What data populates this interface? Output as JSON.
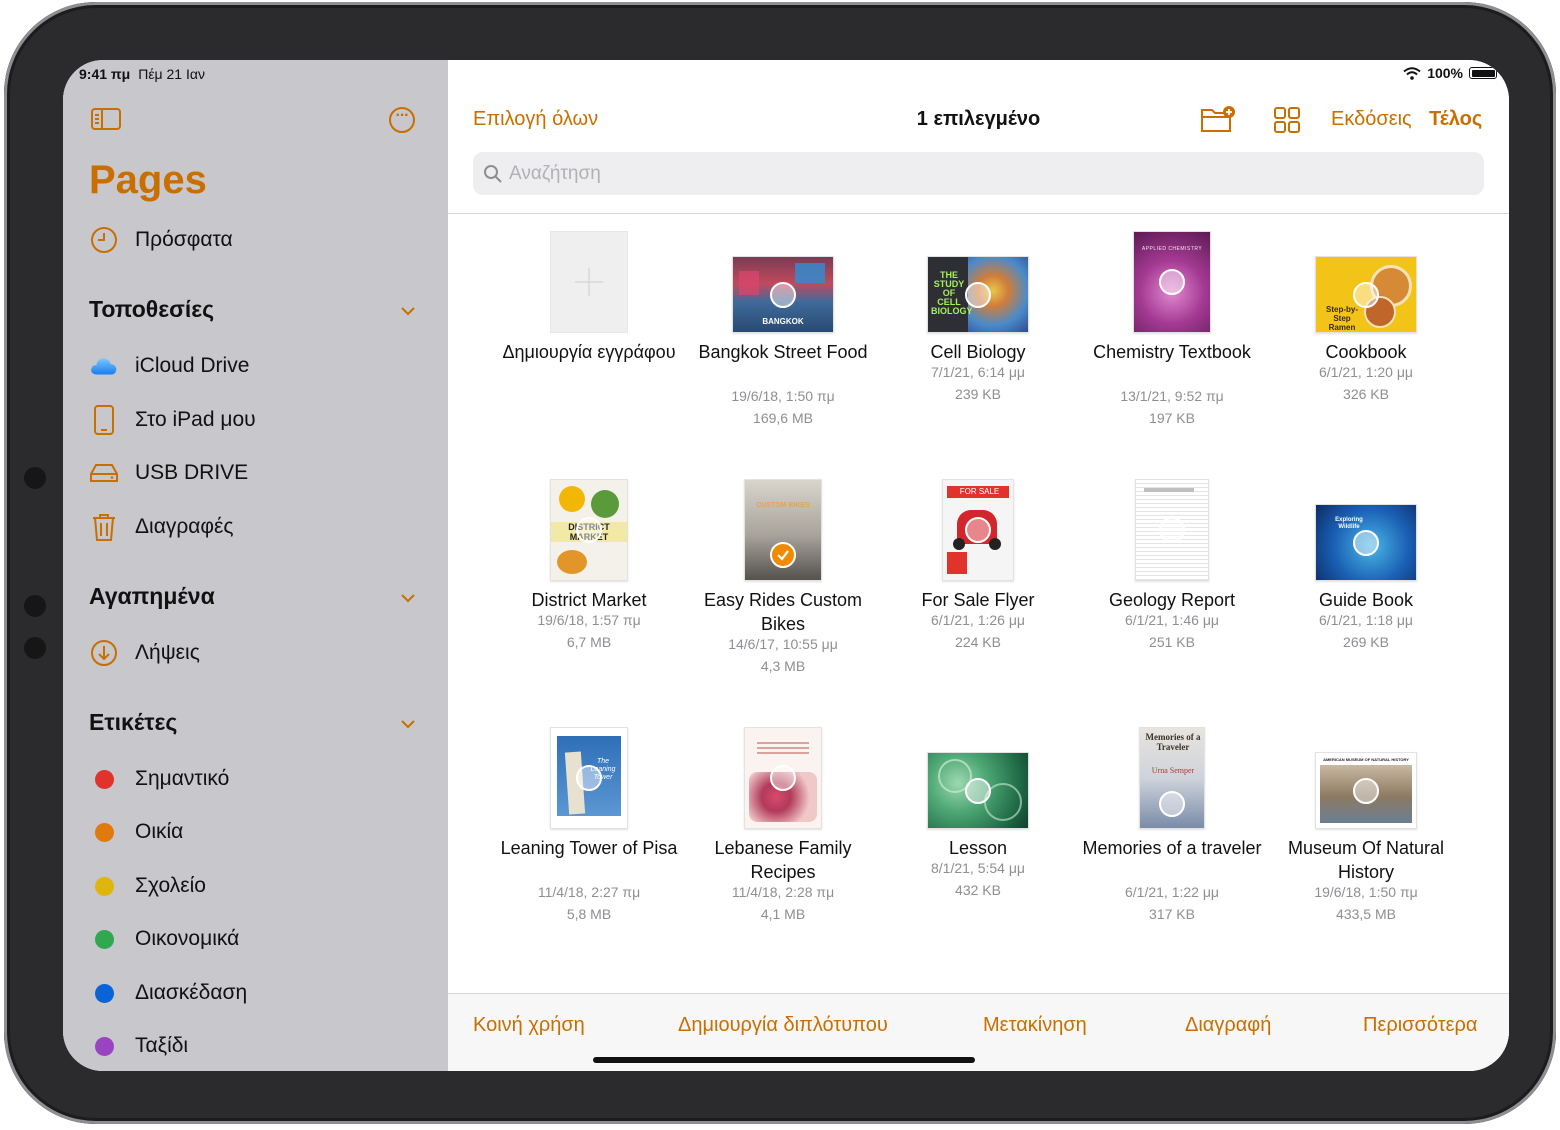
{
  "status": {
    "time": "9:41 πμ",
    "date": "Πέμ 21 Ιαν",
    "battery": "100%"
  },
  "sidebar": {
    "app_title": "Pages",
    "recent": "Πρόσφατα",
    "locations_header": "Τοποθεσίες",
    "locations": [
      {
        "label": "iCloud Drive",
        "icon": "icloud-icon"
      },
      {
        "label": "Στο iPad μου",
        "icon": "ipad-icon"
      },
      {
        "label": "USB DRIVE",
        "icon": "drive-icon"
      },
      {
        "label": "Διαγραφές",
        "icon": "trash-icon"
      }
    ],
    "favorites_header": "Αγαπημένα",
    "favorites": [
      {
        "label": "Λήψεις",
        "icon": "download-icon"
      }
    ],
    "tags_header": "Ετικέτες",
    "tags": [
      {
        "label": "Σημαντικό",
        "color": "#e0332c"
      },
      {
        "label": "Οικία",
        "color": "#e07a0e"
      },
      {
        "label": "Σχολείο",
        "color": "#e0b50e"
      },
      {
        "label": "Οικονομικά",
        "color": "#2fa84f"
      },
      {
        "label": "Διασκέδαση",
        "color": "#0a64d8"
      },
      {
        "label": "Ταξίδι",
        "color": "#9b44c2"
      }
    ]
  },
  "header": {
    "select_all": "Επιλογή όλων",
    "title": "1 επιλεγμένο",
    "versions": "Εκδόσεις",
    "done": "Τέλος",
    "search_placeholder": "Αναζήτηση"
  },
  "documents": [
    {
      "name": "Δημιουργία εγγράφου",
      "date": "",
      "size": ""
    },
    {
      "name": "Bangkok Street Food",
      "date": "19/6/18, 1:50 πμ",
      "size": "169,6 MB"
    },
    {
      "name": "Cell Biology",
      "date": "7/1/21, 6:14 μμ",
      "size": "239 KB"
    },
    {
      "name": "Chemistry Textbook",
      "date": "13/1/21, 9:52 πμ",
      "size": "197 KB"
    },
    {
      "name": "Cookbook",
      "date": "6/1/21, 1:20 μμ",
      "size": "326 KB"
    },
    {
      "name": "District Market",
      "date": "19/6/18, 1:57 πμ",
      "size": "6,7 MB"
    },
    {
      "name": "Easy Rides Custom Bikes",
      "date": "14/6/17, 10:55 μμ",
      "size": "4,3 MB"
    },
    {
      "name": "For Sale Flyer",
      "date": "6/1/21, 1:26 μμ",
      "size": "224 KB"
    },
    {
      "name": "Geology Report",
      "date": "6/1/21, 1:46 μμ",
      "size": "251 KB"
    },
    {
      "name": "Guide Book",
      "date": "6/1/21, 1:18 μμ",
      "size": "269 KB"
    },
    {
      "name": "Leaning Tower of Pisa",
      "date": "11/4/18, 2:27 πμ",
      "size": "5,8 MB"
    },
    {
      "name": "Lebanese Family Recipes",
      "date": "11/4/18, 2:28 πμ",
      "size": "4,1 MB"
    },
    {
      "name": "Lesson",
      "date": "8/1/21, 5:54 μμ",
      "size": "432 KB"
    },
    {
      "name": "Memories of a traveler",
      "date": "6/1/21, 1:22 μμ",
      "size": "317 KB"
    },
    {
      "name": "Museum Of Natural History",
      "date": "19/6/18, 1:50 πμ",
      "size": "433,5 MB"
    }
  ],
  "cover_text": {
    "bangkok": "BANGKOK",
    "cell": "THE STUDY OF CELL BIOLOGY",
    "chem": "APPLIED CHEMISTRY",
    "cook": "Step-by-Step Ramen",
    "district": "DISTRICT MARKET",
    "bikes": "CUSTOM BIKES",
    "forsale": "FOR SALE",
    "guide": "Exploring Wildlife",
    "pisa": "The Leaning Tower",
    "memories": "Memories of a Traveler",
    "memories_author": "Urna Semper",
    "museum": "AMERICAN MUSEUM OF NATURAL HISTORY"
  },
  "toolbar": {
    "share": "Κοινή χρήση",
    "duplicate": "Δημιουργία διπλότυπου",
    "move": "Μετακίνηση",
    "delete": "Διαγραφή",
    "more": "Περισσότερα"
  },
  "colors": {
    "accent": "#c96f00",
    "selected": "#f08b00"
  }
}
